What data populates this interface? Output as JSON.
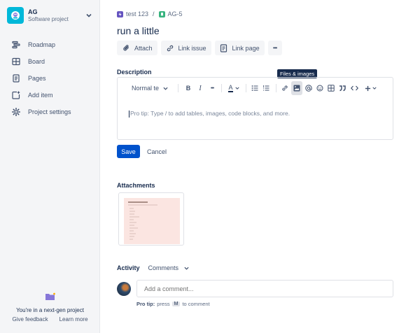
{
  "sidebar": {
    "project": {
      "name": "AG",
      "type": "Software project"
    },
    "items": [
      {
        "label": "Roadmap",
        "icon": "roadmap-icon"
      },
      {
        "label": "Board",
        "icon": "board-icon"
      },
      {
        "label": "Pages",
        "icon": "pages-icon"
      },
      {
        "label": "Add item",
        "icon": "add-item-icon"
      },
      {
        "label": "Project settings",
        "icon": "gear-icon"
      }
    ],
    "promo": {
      "text": "You're in a next-gen project",
      "give_feedback": "Give feedback",
      "learn_more": "Learn more"
    }
  },
  "breadcrumb": {
    "project": "test 123",
    "separator": "/",
    "issue_key": "AG-5"
  },
  "issue": {
    "title": "run a little"
  },
  "actions": {
    "attach": "Attach",
    "link_issue": "Link issue",
    "link_page": "Link page",
    "more": "•••"
  },
  "description": {
    "label": "Description",
    "tooltip": "Files & images",
    "toolbar": {
      "text_style": "Normal te",
      "bold": "B",
      "italic": "I",
      "more_formatting": "•••",
      "text_color": "A"
    },
    "placeholder": "Pro tip: Type / to add tables, images, code blocks, and more."
  },
  "buttons": {
    "save": "Save",
    "cancel": "Cancel"
  },
  "attachments": {
    "label": "Attachments"
  },
  "activity": {
    "label": "Activity",
    "filter": "Comments",
    "comment_placeholder": "Add a comment...",
    "protip_label": "Pro tip:",
    "protip_press": "press",
    "protip_key": "M",
    "protip_suffix": "to comment"
  },
  "colors": {
    "primary": "#0052cc",
    "project_avatar": "#00b8d9",
    "breadcrumb_project_icon": "#6554c0",
    "breadcrumb_issue_icon": "#36b37e",
    "tooltip_bg": "#172b4d"
  }
}
